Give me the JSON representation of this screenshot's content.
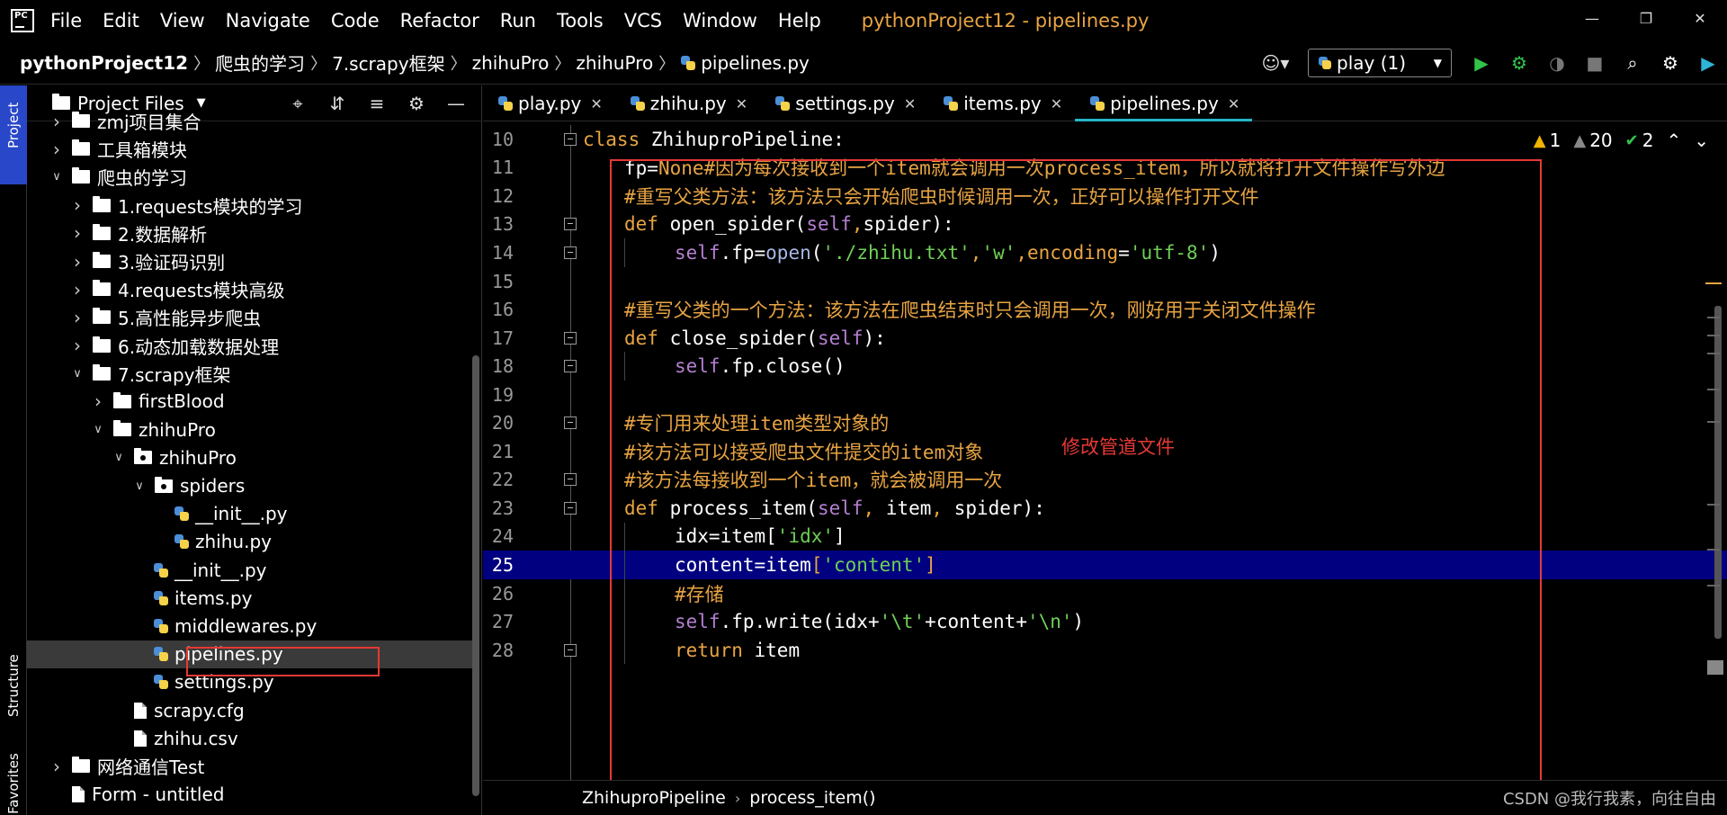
{
  "menubar": {
    "items": [
      "File",
      "Edit",
      "View",
      "Navigate",
      "Code",
      "Refactor",
      "Run",
      "Tools",
      "VCS",
      "Window",
      "Help"
    ],
    "title": "pythonProject12 - pipelines.py"
  },
  "navbar": {
    "breadcrumbs": [
      "pythonProject12",
      "爬虫的学习",
      "7.scrapy框架",
      "zhihuPro",
      "zhihuPro",
      "pipelines.py"
    ],
    "run_config": "play (1)"
  },
  "left_strip": {
    "project": "Project",
    "structure": "Structure",
    "favorites": "Favorites"
  },
  "project_panel": {
    "title": "Project Files",
    "tree": [
      {
        "label": "zmj项目集合",
        "depth": 1,
        "type": "folder",
        "state": "collapsed"
      },
      {
        "label": "工具箱模块",
        "depth": 1,
        "type": "folder",
        "state": "collapsed"
      },
      {
        "label": "爬虫的学习",
        "depth": 1,
        "type": "folder",
        "state": "expanded"
      },
      {
        "label": "1.requests模块的学习",
        "depth": 2,
        "type": "folder",
        "state": "collapsed"
      },
      {
        "label": "2.数据解析",
        "depth": 2,
        "type": "folder",
        "state": "collapsed"
      },
      {
        "label": "3.验证码识别",
        "depth": 2,
        "type": "folder",
        "state": "collapsed"
      },
      {
        "label": "4.requests模块高级",
        "depth": 2,
        "type": "folder",
        "state": "collapsed"
      },
      {
        "label": "5.高性能异步爬虫",
        "depth": 2,
        "type": "folder",
        "state": "collapsed"
      },
      {
        "label": "6.动态加载数据处理",
        "depth": 2,
        "type": "folder",
        "state": "collapsed"
      },
      {
        "label": "7.scrapy框架",
        "depth": 2,
        "type": "folder",
        "state": "expanded"
      },
      {
        "label": "firstBlood",
        "depth": 3,
        "type": "folder",
        "state": "collapsed"
      },
      {
        "label": "zhihuPro",
        "depth": 3,
        "type": "folder",
        "state": "expanded"
      },
      {
        "label": "zhihuPro",
        "depth": 4,
        "type": "package",
        "state": "expanded"
      },
      {
        "label": "spiders",
        "depth": 5,
        "type": "package",
        "state": "expanded"
      },
      {
        "label": "__init__.py",
        "depth": 6,
        "type": "py",
        "state": "none"
      },
      {
        "label": "zhihu.py",
        "depth": 6,
        "type": "py",
        "state": "none"
      },
      {
        "label": "__init__.py",
        "depth": 5,
        "type": "py",
        "state": "none"
      },
      {
        "label": "items.py",
        "depth": 5,
        "type": "py",
        "state": "none"
      },
      {
        "label": "middlewares.py",
        "depth": 5,
        "type": "py",
        "state": "none"
      },
      {
        "label": "pipelines.py",
        "depth": 5,
        "type": "py",
        "state": "selected"
      },
      {
        "label": "settings.py",
        "depth": 5,
        "type": "py",
        "state": "none"
      },
      {
        "label": "scrapy.cfg",
        "depth": 4,
        "type": "file",
        "state": "none"
      },
      {
        "label": "zhihu.csv",
        "depth": 4,
        "type": "file",
        "state": "none"
      },
      {
        "label": "网络通信Test",
        "depth": 1,
        "type": "folder",
        "state": "collapsed"
      },
      {
        "label": "Form - untitled",
        "depth": 1,
        "type": "file",
        "state": "none"
      }
    ]
  },
  "editor": {
    "tabs": [
      {
        "label": "play.py",
        "active": false
      },
      {
        "label": "zhihu.py",
        "active": false
      },
      {
        "label": "settings.py",
        "active": false
      },
      {
        "label": "items.py",
        "active": false
      },
      {
        "label": "pipelines.py",
        "active": true
      }
    ],
    "inspections": {
      "warnings": "1",
      "weak_warnings": "20",
      "typos": "2"
    },
    "current_line": 25,
    "lines": [
      {
        "n": "10",
        "indent": 0,
        "fold": true,
        "tokens": [
          [
            "kw",
            "class "
          ],
          [
            "cls",
            "ZhihuproPipeline:"
          ]
        ]
      },
      {
        "n": "11",
        "indent": 1,
        "fold": false,
        "tokens": [
          [
            "nm",
            "fp="
          ],
          [
            "kw",
            "None"
          ],
          [
            "cmt",
            "#因为每次接收到一个item就会调用一次process_item，所以就将打开文件操作写外边"
          ]
        ]
      },
      {
        "n": "12",
        "indent": 1,
        "fold": false,
        "tokens": [
          [
            "cmt",
            "#重写父类方法：该方法只会开始爬虫时候调用一次，正好可以操作打开文件"
          ]
        ]
      },
      {
        "n": "13",
        "indent": 1,
        "fold": true,
        "tokens": [
          [
            "kw",
            "def "
          ],
          [
            "fn",
            "open_spider"
          ],
          [
            "nm",
            "("
          ],
          [
            "self",
            "self"
          ],
          [
            "kw",
            ","
          ],
          [
            "nm",
            "spider):"
          ]
        ]
      },
      {
        "n": "14",
        "indent": 2,
        "fold": true,
        "tokens": [
          [
            "self",
            "self"
          ],
          [
            "nm",
            ".fp="
          ],
          [
            "builtin",
            "open"
          ],
          [
            "nm",
            "("
          ],
          [
            "str",
            "'./zhihu.txt'"
          ],
          [
            "kw",
            ","
          ],
          [
            "str",
            "'w'"
          ],
          [
            "kw",
            ","
          ],
          [
            "kwarg",
            "encoding"
          ],
          [
            "nm",
            "="
          ],
          [
            "str",
            "'utf-8'"
          ],
          [
            "nm",
            ")"
          ]
        ]
      },
      {
        "n": "15",
        "indent": 0,
        "fold": false,
        "tokens": []
      },
      {
        "n": "16",
        "indent": 1,
        "fold": false,
        "tokens": [
          [
            "cmt",
            "#重写父类的一个方法：该方法在爬虫结束时只会调用一次，刚好用于关闭文件操作"
          ]
        ]
      },
      {
        "n": "17",
        "indent": 1,
        "fold": true,
        "tokens": [
          [
            "kw",
            "def "
          ],
          [
            "fn",
            "close_spider"
          ],
          [
            "nm",
            "("
          ],
          [
            "self",
            "self"
          ],
          [
            "nm",
            "):"
          ]
        ]
      },
      {
        "n": "18",
        "indent": 2,
        "fold": true,
        "tokens": [
          [
            "self",
            "self"
          ],
          [
            "nm",
            ".fp.close()"
          ]
        ]
      },
      {
        "n": "19",
        "indent": 0,
        "fold": false,
        "tokens": []
      },
      {
        "n": "20",
        "indent": 1,
        "fold": true,
        "tokens": [
          [
            "cmt",
            "#专门用来处理item类型对象的"
          ]
        ]
      },
      {
        "n": "21",
        "indent": 1,
        "fold": false,
        "tokens": [
          [
            "cmt",
            "#该方法可以接受爬虫文件提交的item对象"
          ]
        ]
      },
      {
        "n": "22",
        "indent": 1,
        "fold": true,
        "tokens": [
          [
            "cmt",
            "#该方法每接收到一个item，就会被调用一次"
          ]
        ]
      },
      {
        "n": "23",
        "indent": 1,
        "fold": true,
        "tokens": [
          [
            "kw",
            "def "
          ],
          [
            "fn",
            "process_item"
          ],
          [
            "nm",
            "("
          ],
          [
            "self",
            "self"
          ],
          [
            "kw",
            ", "
          ],
          [
            "nm",
            "item"
          ],
          [
            "kw",
            ", "
          ],
          [
            "nm",
            "spider):"
          ]
        ]
      },
      {
        "n": "24",
        "indent": 2,
        "fold": false,
        "tokens": [
          [
            "nm",
            "idx=item["
          ],
          [
            "str",
            "'idx'"
          ],
          [
            "nm",
            "]"
          ]
        ]
      },
      {
        "n": "25",
        "indent": 2,
        "fold": false,
        "tokens": [
          [
            "nm",
            "content=item"
          ],
          [
            "kw",
            "["
          ],
          [
            "str",
            "'content'"
          ],
          [
            "kw",
            "]"
          ]
        ]
      },
      {
        "n": "26",
        "indent": 2,
        "fold": false,
        "tokens": [
          [
            "cmt",
            "#存储"
          ]
        ]
      },
      {
        "n": "27",
        "indent": 2,
        "fold": false,
        "tokens": [
          [
            "self",
            "self"
          ],
          [
            "nm",
            ".fp.write(idx+"
          ],
          [
            "str",
            "'\\t'"
          ],
          [
            "nm",
            "+content+"
          ],
          [
            "str",
            "'\\n'"
          ],
          [
            "nm",
            ")"
          ]
        ]
      },
      {
        "n": "28",
        "indent": 2,
        "fold": true,
        "tokens": [
          [
            "kw",
            "return "
          ],
          [
            "nm",
            "item"
          ]
        ]
      }
    ],
    "annotation": "修改管道文件",
    "breadcrumb": [
      "ZhihuproPipeline",
      "process_item()"
    ]
  },
  "watermark": "CSDN @我行我素，向往自由",
  "colors": {
    "accent_tab": "#26b4c7",
    "highlight_box": "#e53935",
    "current_line": "#000080",
    "keyword": "#e8a443",
    "string": "#6fcf57",
    "self": "#b47fd1"
  }
}
